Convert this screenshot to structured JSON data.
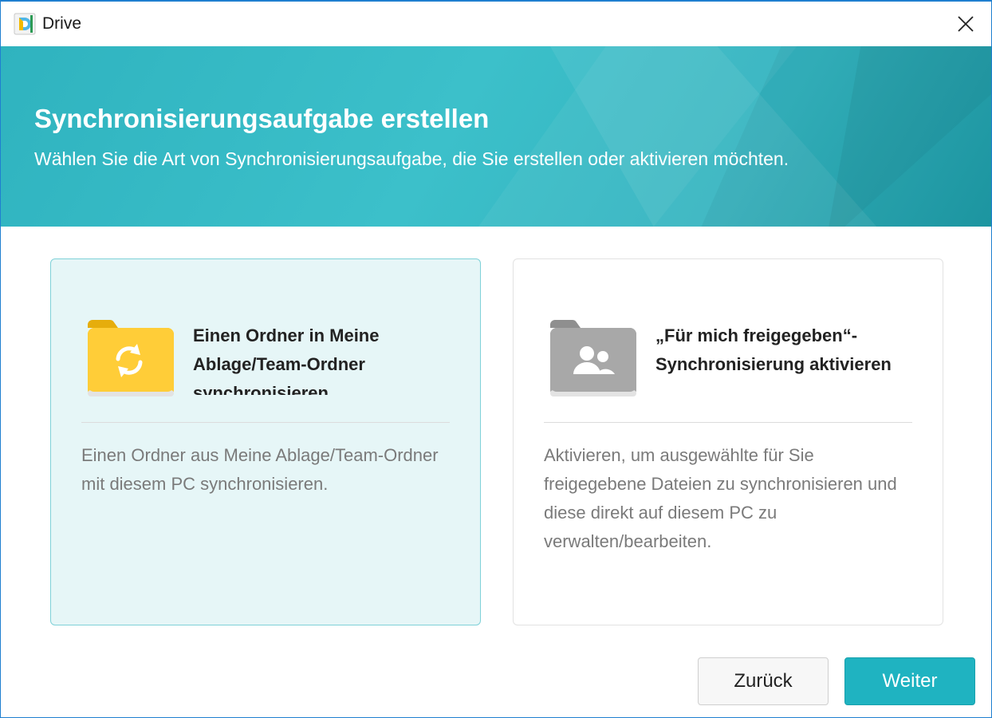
{
  "window": {
    "title": "Drive",
    "app_icon": "drive-logo-icon",
    "close_icon": "close-icon"
  },
  "banner": {
    "title": "Synchronisierungsaufgabe erstellen",
    "subtitle": "Wählen Sie die Art von Synchronisierungsaufgabe, die Sie erstellen oder aktivieren möchten."
  },
  "options": [
    {
      "icon": "yellow-folder-sync-icon",
      "title": "Einen Ordner in Meine Ablage/Team-Ordner synchronisieren",
      "description": "Einen Ordner aus Meine Ablage/Team-Ordner mit diesem PC synchronisieren.",
      "selected": true
    },
    {
      "icon": "gray-folder-shared-icon",
      "title": "„Für mich freigegeben“-Synchronisierung aktivieren",
      "description": "Aktivieren, um ausgewählte für Sie freigegebene Dateien zu synchronisieren und diese direkt auf diesem PC zu verwalten/bearbeiten.",
      "selected": false
    }
  ],
  "footer": {
    "back_label": "Zurück",
    "next_label": "Weiter"
  },
  "colors": {
    "accent": "#1fb3c1",
    "banner": "#3cc0ca",
    "selected_card_bg": "#e6f6f7",
    "folder_yellow": "#ffcd38",
    "folder_gray": "#a8a8a8"
  }
}
